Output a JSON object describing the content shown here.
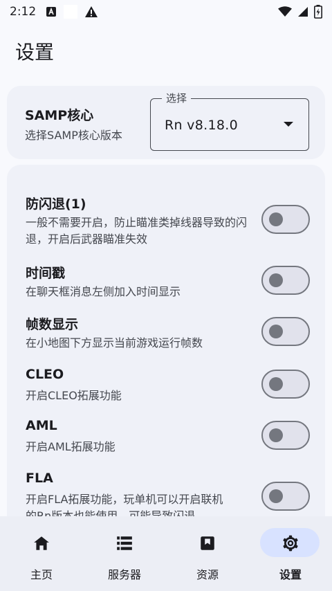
{
  "status_bar": {
    "time": "2:12",
    "left_icons": [
      "a-box-icon",
      "white-square-icon",
      "warning-icon"
    ],
    "right_icons": [
      "wifi-icon",
      "signal-icon",
      "battery-charging-icon"
    ]
  },
  "page": {
    "title": "设置"
  },
  "core": {
    "title": "SAMP核心",
    "description": "选择SAMP核心版本",
    "select_label": "选择",
    "select_value": "Rn v8.18.0"
  },
  "settings": [
    {
      "title": "防闪退(1)",
      "description": "一般不需要开启，防止瞄准类掉线器导致的闪退，开启后武器瞄准失效",
      "enabled": false
    },
    {
      "title": "时间戳",
      "description": "在聊天框消息左侧加入时间显示",
      "enabled": false
    },
    {
      "title": "帧数显示",
      "description": "在小地图下方显示当前游戏运行帧数",
      "enabled": false
    },
    {
      "title": "CLEO",
      "description": "开启CLEO拓展功能",
      "enabled": false
    },
    {
      "title": "AML",
      "description": "开启AML拓展功能",
      "enabled": false
    },
    {
      "title": "FLA",
      "description": "开启FLA拓展功能，玩单机可以开启联机的Rn版本也能使用，可能导致闪退",
      "enabled": false
    }
  ],
  "nav": [
    {
      "label": "主页",
      "icon": "home-icon",
      "active": false
    },
    {
      "label": "服务器",
      "icon": "server-list-icon",
      "active": false
    },
    {
      "label": "资源",
      "icon": "bookmark-box-icon",
      "active": false
    },
    {
      "label": "设置",
      "icon": "gear-icon",
      "active": true
    }
  ],
  "colors": {
    "background": "#f8f9fd",
    "card": "#eff1f8",
    "nav_active_pill": "#d8e2ff",
    "toggle_track_off": "#e1e2ec",
    "toggle_outline": "#74777f"
  }
}
